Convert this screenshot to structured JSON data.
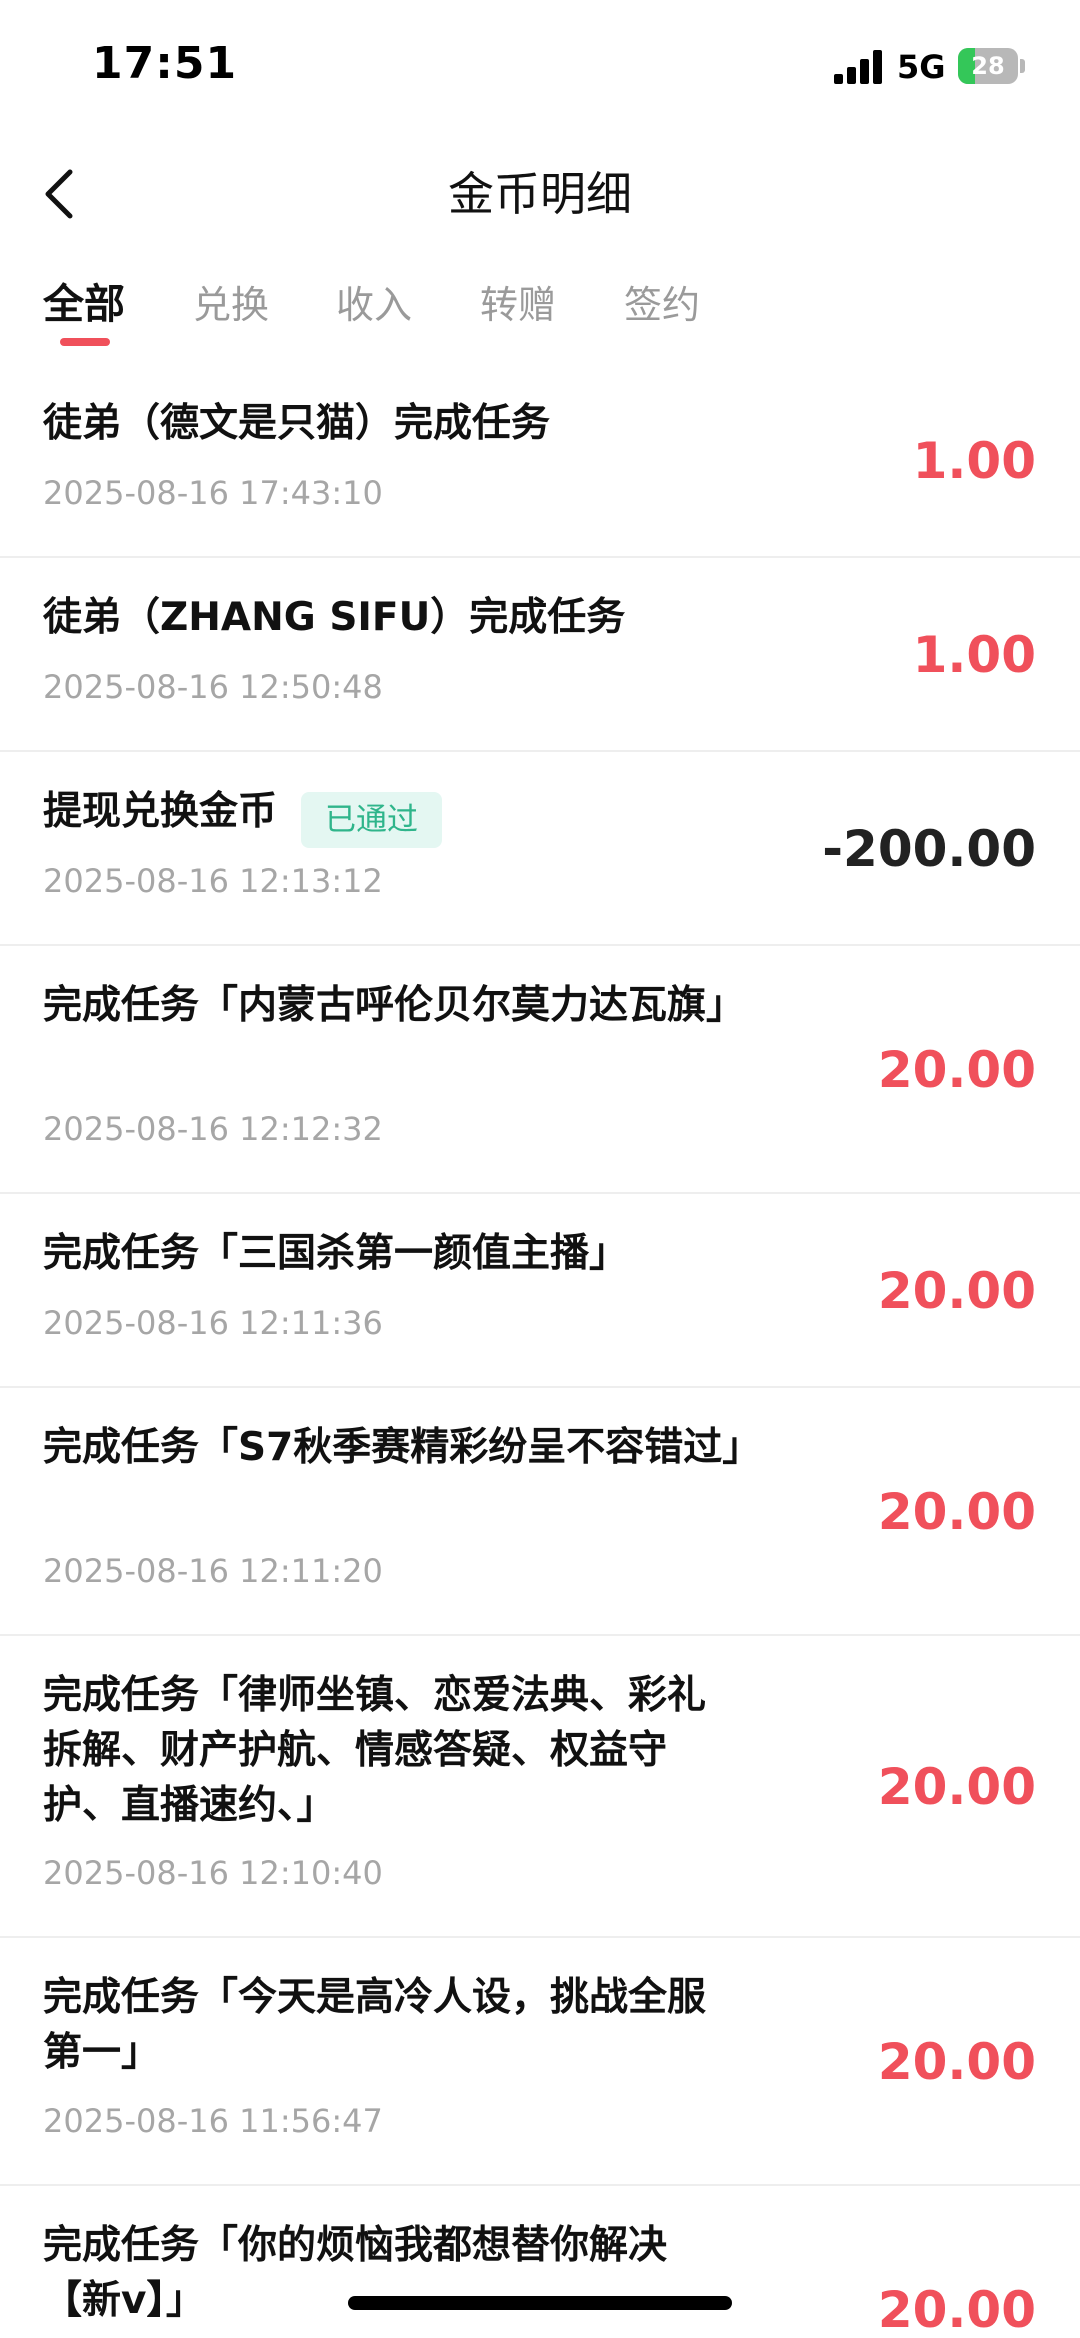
{
  "status_bar": {
    "time": "17:51",
    "network": "5G",
    "battery_level": "28",
    "battery_fraction": 0.28,
    "signal_icon": "cellular-signal-icon",
    "battery_icon": "battery-charging-icon"
  },
  "nav": {
    "title": "金币明细",
    "back_icon": "chevron-left-icon"
  },
  "tabs": [
    {
      "label": "全部",
      "active": true
    },
    {
      "label": "兑换",
      "active": false
    },
    {
      "label": "收入",
      "active": false
    },
    {
      "label": "转赠",
      "active": false
    },
    {
      "label": "签约",
      "active": false
    }
  ],
  "colors": {
    "accent": "#f0505b",
    "badge_bg": "#e4f7f2",
    "badge_text": "#2fb58b",
    "muted_text": "#a6a6a6",
    "divider": "#eeeeee"
  },
  "records": [
    {
      "title": "徒弟（德文是只猫）完成任务",
      "time": "2025-08-16 17:43:10",
      "amount": "1.00",
      "negative": false,
      "badge": ""
    },
    {
      "title": "徒弟（ZHANG SIFU）完成任务",
      "time": "2025-08-16 12:50:48",
      "amount": "1.00",
      "negative": false,
      "badge": ""
    },
    {
      "title": "提现兑换金币",
      "time": "2025-08-16 12:13:12",
      "amount": "-200.00",
      "negative": true,
      "badge": "已通过"
    },
    {
      "title": "完成任务「内蒙古呼伦贝尔莫力达瓦旗」",
      "time": "2025-08-16 12:12:32",
      "amount": "20.00",
      "negative": false,
      "badge": ""
    },
    {
      "title": "完成任务「三国杀第一颜值主播」",
      "time": "2025-08-16 12:11:36",
      "amount": "20.00",
      "negative": false,
      "badge": ""
    },
    {
      "title": "完成任务「S7秋季赛精彩纷呈不容错过」",
      "time": "2025-08-16 12:11:20",
      "amount": "20.00",
      "negative": false,
      "badge": ""
    },
    {
      "title": "完成任务「律师坐镇、恋爱法典、彩礼拆解、财产护航、情感答疑、权益守护、直播速约、」",
      "time": "2025-08-16 12:10:40",
      "amount": "20.00",
      "negative": false,
      "badge": ""
    },
    {
      "title": "完成任务「今天是高冷人设，挑战全服第一」",
      "time": "2025-08-16 11:56:47",
      "amount": "20.00",
      "negative": false,
      "badge": ""
    },
    {
      "title": "完成任务「你的烦恼我都想替你解决【新v】」",
      "time": "",
      "amount": "20.00",
      "negative": false,
      "badge": ""
    }
  ]
}
